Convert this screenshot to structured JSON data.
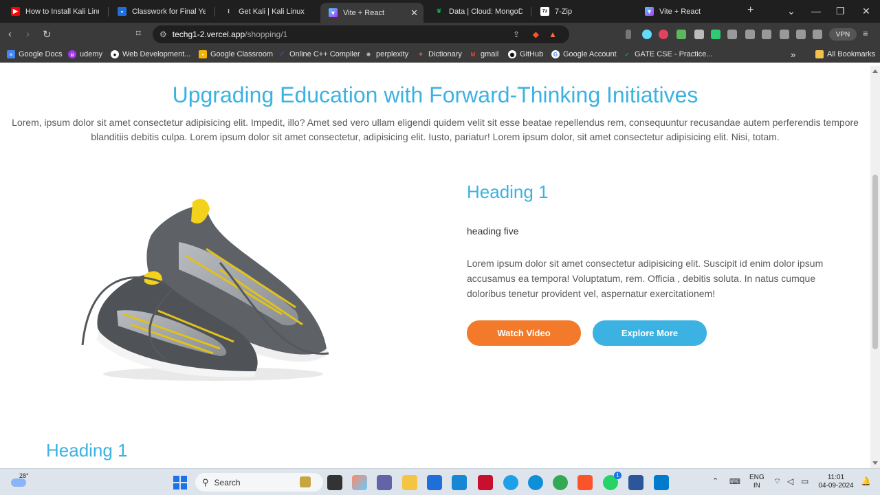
{
  "tabs": [
    {
      "title": "How to Install Kali Linux in",
      "icon": "youtube-icon",
      "color": "#ff0000"
    },
    {
      "title": "Classwork for Final Year C",
      "icon": "classroom-icon",
      "color": "#1e8e3e"
    },
    {
      "title": "Get Kali | Kali Linux",
      "icon": "kali-icon",
      "color": "#3a3a3a"
    },
    {
      "title": "Vite + React",
      "icon": "vite-icon",
      "color": "#8a63f5",
      "active": true
    },
    {
      "title": "Data | Cloud: MongoDB C",
      "icon": "mongodb-icon",
      "color": "#13aa52"
    },
    {
      "title": "7-Zip",
      "icon": "7zip-icon",
      "color": "#222222"
    },
    {
      "title": "Vite + React",
      "icon": "vite-icon",
      "color": "#8a63f5"
    }
  ],
  "address": {
    "host": "techg1-2.vercel.app",
    "path": "/shopping/1"
  },
  "vpn_label": "VPN",
  "bookmarks": [
    {
      "label": "Google Docs",
      "color": "#4285f4"
    },
    {
      "label": "udemy",
      "color": "#a435f0"
    },
    {
      "label": "Web Development...",
      "color": "#f4b400"
    },
    {
      "label": "Google Classroom",
      "color": "#1e8e3e"
    },
    {
      "label": "Online C++ Compiler",
      "color": "#6a4cff"
    },
    {
      "label": "perplexity",
      "color": "#222222"
    },
    {
      "label": "Dictionary",
      "color": "#c0392b"
    },
    {
      "label": "gmail",
      "color": "#ea4335"
    },
    {
      "label": "GitHub",
      "color": "#111111"
    },
    {
      "label": "Google Account",
      "color": "#4285f4"
    },
    {
      "label": "GATE CSE - Practice...",
      "color": "#1aa260"
    }
  ],
  "all_bookmarks_label": "All Bookmarks",
  "page": {
    "title": "Upgrading Education with Forward-Thinking Initiatives",
    "intro": "Lorem, ipsum dolor sit amet consectetur adipisicing elit. Impedit, illo? Amet sed vero ullam eligendi quidem velit sit esse beatae repellendus rem, consequuntur recusandae autem perferendis tempore blanditiis debitis culpa. Lorem ipsum dolor sit amet consectetur, adipisicing elit. Iusto, pariatur! Lorem ipsum dolor, sit amet consectetur adipisicing elit. Nisi, totam.",
    "card": {
      "heading": "Heading 1",
      "subheading": "heading five",
      "text": "Lorem ipsum dolor sit amet consectetur adipisicing elit. Suscipit id enim dolor ipsum accusamus ea tempora! Voluptatum, rem. Officia , debitis soluta. In natus cumque doloribus tenetur provident vel, aspernatur exercitationem!",
      "watch_label": "Watch Video",
      "explore_label": "Explore More"
    },
    "next_heading": "Heading 1"
  },
  "colors": {
    "accent": "#3bb2e2",
    "orange": "#f27a2a"
  },
  "taskbar": {
    "weather": "28°",
    "search_placeholder": "Search",
    "lang": "ENG",
    "region": "IN",
    "time": "11:01",
    "date": "04-09-2024",
    "whatsapp_badge": "1"
  }
}
